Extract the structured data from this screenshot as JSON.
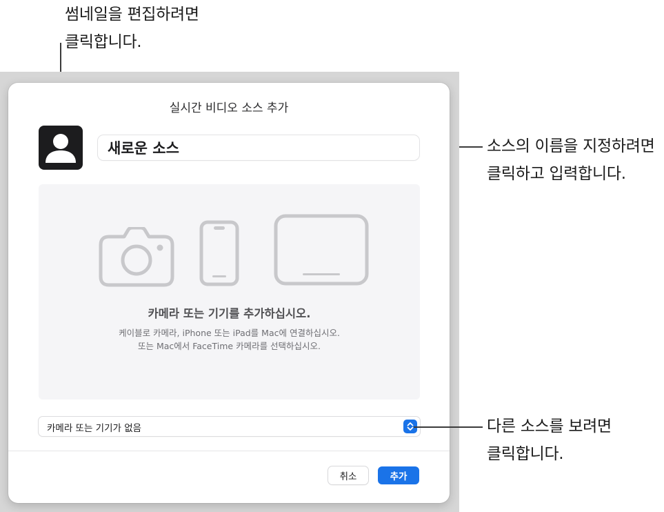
{
  "callouts": {
    "thumbnail": [
      "썸네일을 편집하려면",
      "클릭합니다."
    ],
    "name": [
      "소스의 이름을 지정하려면",
      "클릭하고 입력합니다."
    ],
    "source": [
      "다른 소스를 보려면",
      "클릭합니다."
    ]
  },
  "dialog": {
    "title": "실시간 비디오 소스 추가",
    "thumbnail_icon": "person-silhouette-icon",
    "name_value": "새로운 소스",
    "panel": {
      "icons": [
        "camera-icon",
        "iphone-icon",
        "ipad-icon"
      ],
      "heading": "카메라 또는 기기를 추가하십시오.",
      "body": [
        "케이블로 카메라, iPhone 또는 iPad를 Mac에 연결하십시오.",
        "또는 Mac에서 FaceTime 카메라를 선택하십시오."
      ]
    },
    "source_select": {
      "selected": "카메라 또는 기기가 없음",
      "icon": "chevron-updown-icon"
    },
    "buttons": {
      "cancel": "취소",
      "add": "추가"
    }
  },
  "colors": {
    "accent": "#1a73e8",
    "backdrop": "#d6d6d6",
    "panel": "#f5f5f7",
    "device_icon": "#c8c8cb"
  }
}
